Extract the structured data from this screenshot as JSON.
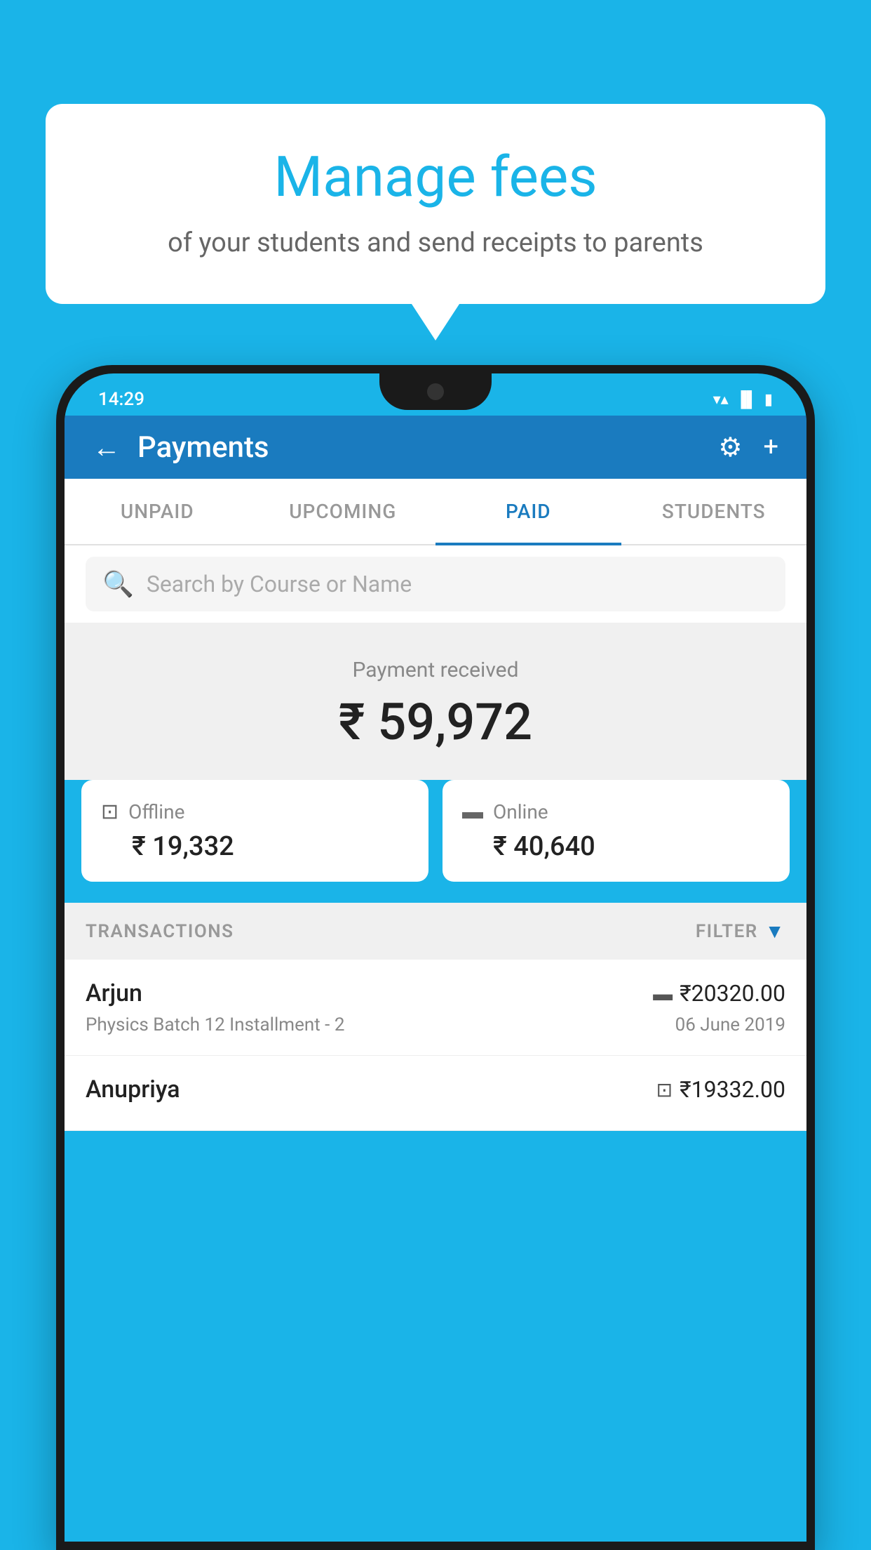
{
  "background_color": "#1ab4e8",
  "bubble": {
    "title": "Manage fees",
    "subtitle": "of your students and send receipts to parents"
  },
  "status_bar": {
    "time": "14:29",
    "icons": [
      "wifi",
      "signal",
      "battery"
    ]
  },
  "header": {
    "title": "Payments",
    "back_label": "←",
    "settings_label": "⚙",
    "add_label": "+"
  },
  "tabs": [
    {
      "label": "UNPAID",
      "active": false
    },
    {
      "label": "UPCOMING",
      "active": false
    },
    {
      "label": "PAID",
      "active": true
    },
    {
      "label": "STUDENTS",
      "active": false
    }
  ],
  "search": {
    "placeholder": "Search by Course or Name"
  },
  "payment_received": {
    "label": "Payment received",
    "amount": "₹ 59,972"
  },
  "payment_cards": [
    {
      "type": "Offline",
      "amount": "₹ 19,332",
      "icon": "rupee-card"
    },
    {
      "type": "Online",
      "amount": "₹ 40,640",
      "icon": "credit-card"
    }
  ],
  "transactions_label": "TRANSACTIONS",
  "filter_label": "FILTER",
  "transactions": [
    {
      "name": "Arjun",
      "course": "Physics Batch 12 Installment - 2",
      "amount": "₹20320.00",
      "date": "06 June 2019",
      "payment_type": "card"
    },
    {
      "name": "Anupriya",
      "course": "",
      "amount": "₹19332.00",
      "date": "",
      "payment_type": "rupee"
    }
  ]
}
